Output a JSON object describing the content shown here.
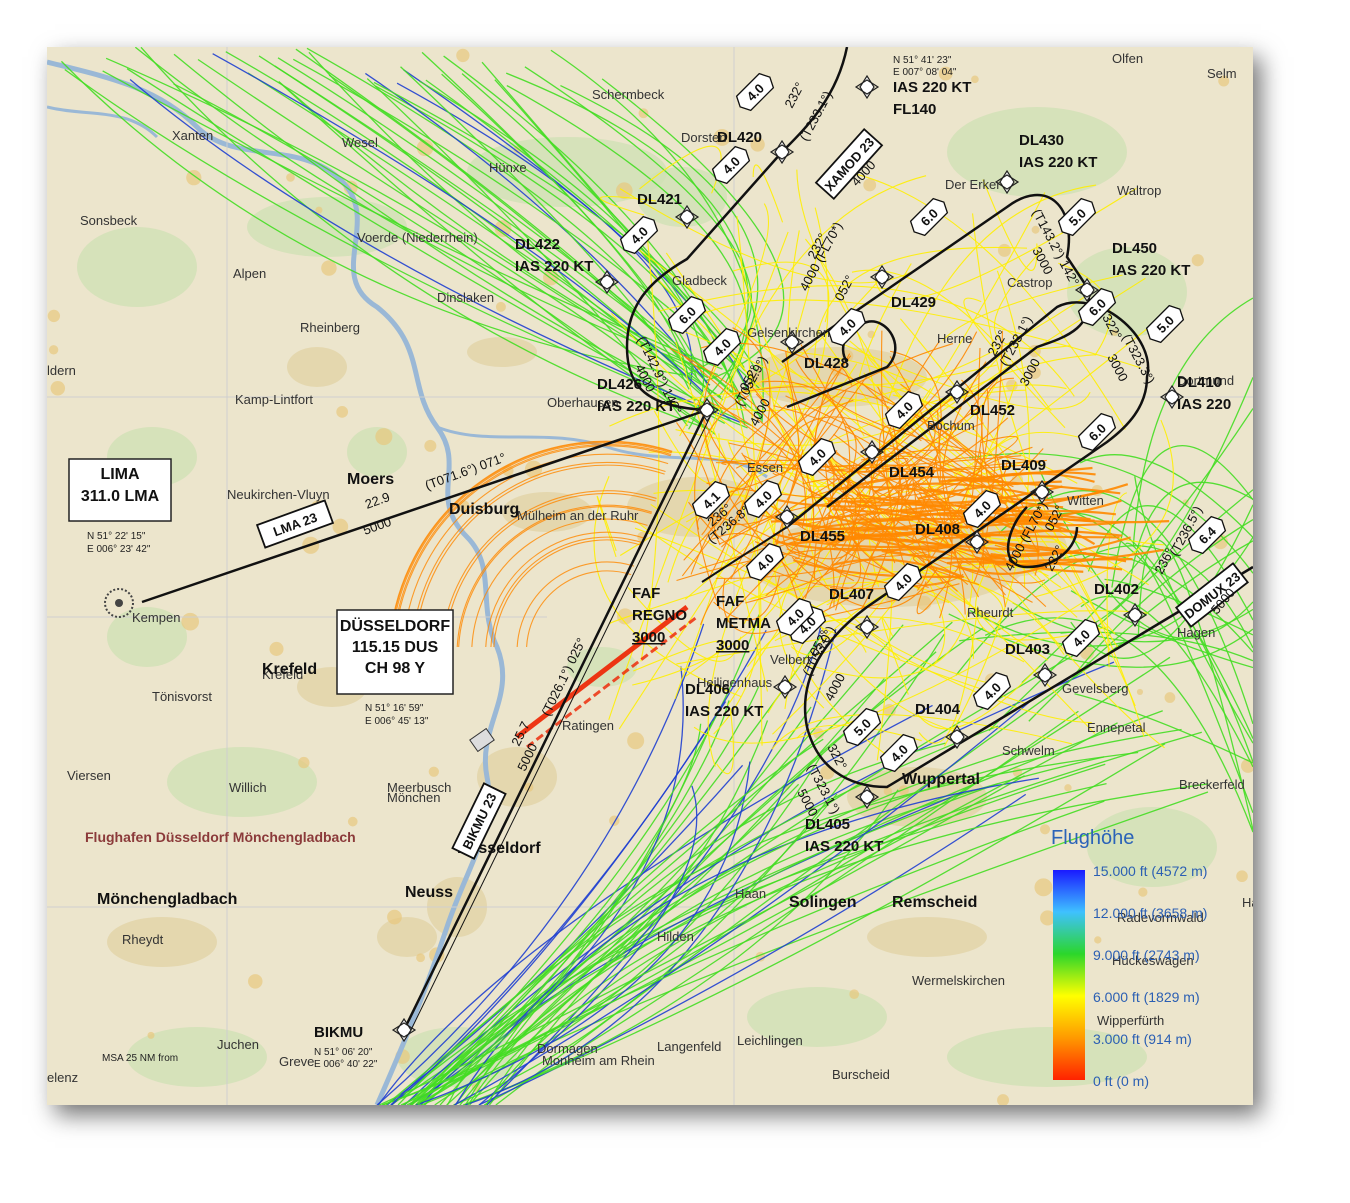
{
  "map": {
    "towns": [
      "Schermbeck",
      "Dorsten",
      "Olfen",
      "Selm",
      "Xanten",
      "Wesel",
      "Hünxe",
      "Sonsbeck",
      "Voerde (Niederrhein)",
      "Alpen",
      "Dinslaken",
      "Rheinberg",
      "Gladbeck",
      "Waltrop",
      "Castrop",
      "Kamp-Lintfort",
      "Neukirchen-Vluyn",
      "Kempen",
      "Krefeld",
      "Tönisvorst",
      "Viersen",
      "Willich",
      "Meerbusch",
      "Ratingen",
      "Velbert",
      "Heiligenhaus",
      "Hilden",
      "Haan",
      "Dormagen",
      "Monheim am Rhein",
      "Langenfeld",
      "Leichlingen",
      "Burscheid",
      "Wermelskirchen",
      "Ennepetal",
      "Breckerfeld",
      "Schwelm",
      "Gevelsberg",
      "Hagen",
      "Wipperfürth",
      "Bochum",
      "Herne",
      "Mülheim an der Ruhr",
      "Rheydt",
      "Greve",
      "Juchen",
      "elenz",
      "ldern",
      "Hückeswagen",
      "Halver",
      "Radevormwald",
      "Gelsenkirchen",
      "Essen",
      "Oberhausen",
      "Witten",
      "Dortmund",
      "Der Erker",
      "Rheurdt",
      "Mönchen"
    ],
    "big_towns": [
      "Duisburg",
      "Moers",
      "Krefeld",
      "Neuss",
      "Düsseldorf",
      "Mönchengladbach",
      "Solingen",
      "Remscheid",
      "Wuppertal"
    ],
    "airport": "Flughafen Düsseldorf Mönchengladbach"
  },
  "navaids": {
    "lima": {
      "name": "LIMA",
      "freq": "311.0 LMA",
      "coord1": "N 51° 22' 15\"",
      "coord2": "E 006° 23' 42\""
    },
    "dus": {
      "name": "DÜSSELDORF",
      "freq": "115.15 DUS",
      "channel": "CH  98  Y",
      "coord1": "N 51° 16' 59\"",
      "coord2": "E 006° 45' 13\""
    }
  },
  "waypoints": [
    {
      "id": "DL420",
      "lines": [
        "DL420"
      ]
    },
    {
      "id": "DL421",
      "lines": [
        "DL421"
      ]
    },
    {
      "id": "DL422",
      "lines": [
        "DL422",
        "IAS 220 KT"
      ]
    },
    {
      "id": "DL426",
      "lines": [
        "DL426",
        "IAS 220 KT"
      ]
    },
    {
      "id": "DL428",
      "lines": [
        "DL428"
      ]
    },
    {
      "id": "DL429",
      "lines": [
        "DL429"
      ]
    },
    {
      "id": "DL430",
      "lines": [
        "DL430",
        "IAS 220 KT"
      ]
    },
    {
      "id": "DL450",
      "lines": [
        "DL450",
        "IAS 220 KT"
      ]
    },
    {
      "id": "DL410",
      "lines": [
        "DL410",
        "IAS 220"
      ]
    },
    {
      "id": "DL452",
      "lines": [
        "DL452"
      ]
    },
    {
      "id": "DL454",
      "lines": [
        "DL454"
      ]
    },
    {
      "id": "DL409",
      "lines": [
        "DL409"
      ]
    },
    {
      "id": "DL455",
      "lines": [
        "DL455"
      ]
    },
    {
      "id": "DL408",
      "lines": [
        "DL408"
      ]
    },
    {
      "id": "DL407",
      "lines": [
        "DL407"
      ]
    },
    {
      "id": "DL402",
      "lines": [
        "DL402"
      ]
    },
    {
      "id": "DL403",
      "lines": [
        "DL403"
      ]
    },
    {
      "id": "DL404",
      "lines": [
        "DL404"
      ]
    },
    {
      "id": "DL406",
      "lines": [
        "DL406",
        "IAS 220 KT"
      ]
    },
    {
      "id": "DL405",
      "lines": [
        "DL405",
        "IAS 220 KT"
      ]
    },
    {
      "id": "BIKMU",
      "lines": [
        "BIKMU"
      ]
    },
    {
      "id": "XAMOD",
      "lines": [
        "IAS 220 KT",
        "FL140"
      ]
    }
  ],
  "faf": [
    {
      "lines": [
        "FAF",
        "REGNO",
        "3000"
      ]
    },
    {
      "lines": [
        "FAF",
        "METMA",
        "3000"
      ]
    }
  ],
  "coords": {
    "xamod1": "N 51° 41' 23\"",
    "xamod2": "E 007° 08' 04\"",
    "bikmu1": "N 51° 06' 20\"",
    "bikmu2": "E 006° 40' 22\""
  },
  "routes": {
    "lma": "LMA 23",
    "bikmu": "BIKMU 23",
    "xamod": "XAMOD 23",
    "domux": "DOMUX 23"
  },
  "track_labels": [
    "(T071.6°) 071°",
    "22.9",
    "5000",
    "(T026.1°) 025°",
    "25.7",
    "5000",
    "(T233.1°)",
    "232°",
    "4000",
    "(T142.9°) 142°",
    "4000",
    "(T143.2°) 142°",
    "3000",
    "(T233.1°)",
    "3000",
    "232°",
    "(T323.3°)",
    "322°",
    "3000",
    "(T052.9°)",
    "052°",
    "4000",
    "(T236.8°)",
    "236°",
    "(T053.0°)",
    "052°",
    "4000",
    "(T323.1°)",
    "322°",
    "5000",
    "(T236.5°)",
    "236°",
    "5000",
    "232°",
    "4000 (FL70*)",
    "052°",
    "052°",
    "4000 (FL70*)",
    "232°"
  ],
  "distances": [
    "4.0",
    "4.0",
    "4.0",
    "6.0",
    "4.0",
    "4.0",
    "6.0",
    "5.0",
    "6.0",
    "4.0",
    "5.0",
    "4.0",
    "4.0",
    "6.0",
    "4.1",
    "4.0",
    "4.0",
    "4.0",
    "4.0",
    "4.0",
    "4.0",
    "5.0",
    "4.0",
    "4.0",
    "6.4"
  ],
  "msa": "MSA 25 NM from",
  "legend": {
    "title": "Flughöhe",
    "labels": [
      "15.000 ft (4572 m)",
      "12.000 ft (3658 m)",
      "9.000 ft (2743 m)",
      "6.000 ft (1829 m)",
      "3.000 ft (914 m)",
      "0 ft (0 m)"
    ],
    "colors": [
      "#1a1aff",
      "#3fc1ff",
      "#2bd62b",
      "#ffff00",
      "#ff9900",
      "#ff2200"
    ]
  },
  "traffic_colors": {
    "high": "#1f3fd0",
    "mid": "#44dd22",
    "low_mid": "#ffee00",
    "low": "#ff8800",
    "lowest": "#ee2200"
  }
}
